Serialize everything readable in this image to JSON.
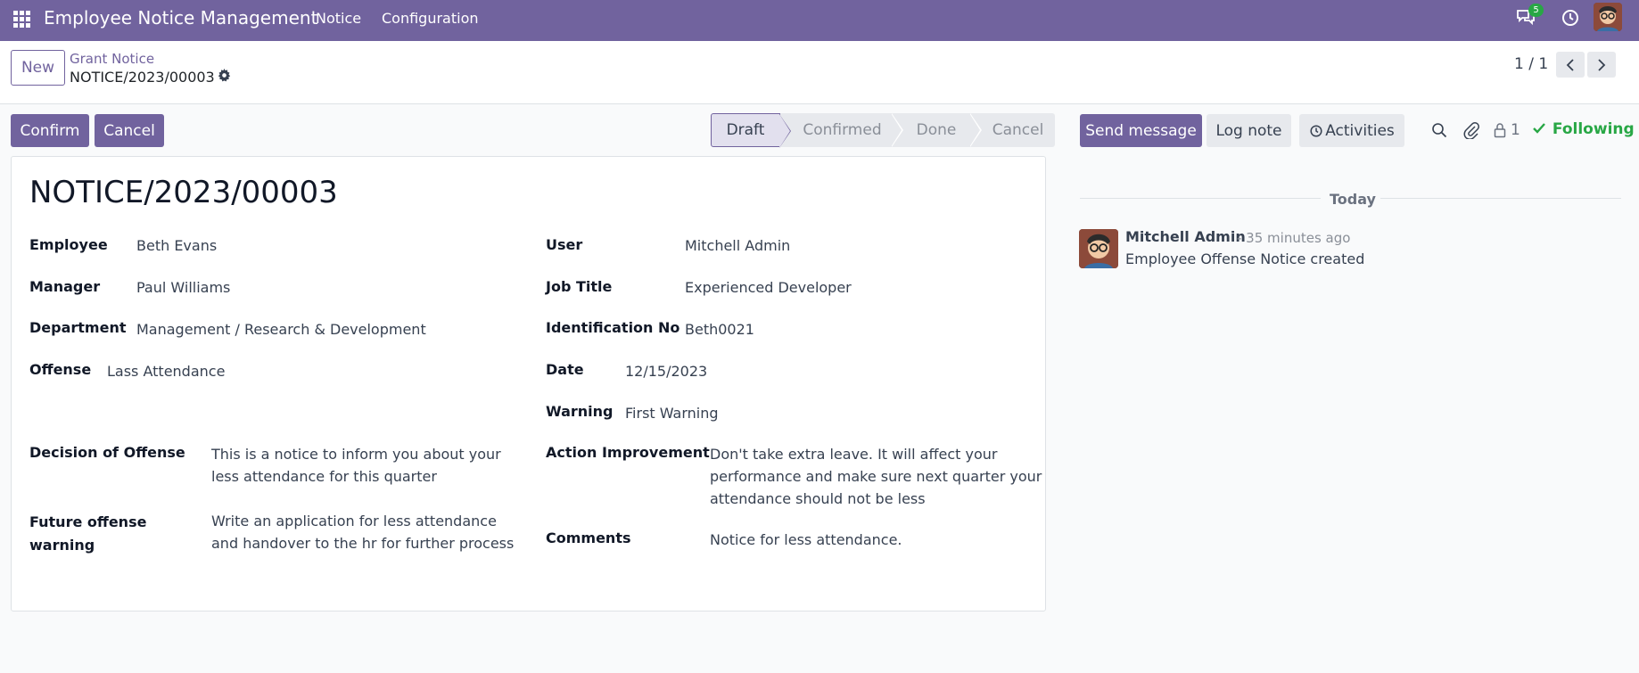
{
  "navbar": {
    "app_title": "Employee Notice Management",
    "menu": [
      "Notice",
      "Configuration"
    ],
    "messages_badge": "5",
    "accent": "#71639e"
  },
  "control_panel": {
    "new_label": "New",
    "breadcrumb_parent": "Grant Notice",
    "breadcrumb_current": "NOTICE/2023/00003",
    "pager": "1 / 1"
  },
  "actions": {
    "confirm": "Confirm",
    "cancel": "Cancel"
  },
  "statusbar": {
    "stages": [
      "Draft",
      "Confirmed",
      "Done",
      "Cancel"
    ],
    "active": "Draft"
  },
  "form": {
    "title": "NOTICE/2023/00003",
    "employee_label": "Employee",
    "employee": "Beth Evans",
    "manager_label": "Manager",
    "manager": "Paul Williams",
    "department_label": "Department",
    "department": "Management / Research & Development",
    "offense_label": "Offense",
    "offense": "Lass Attendance",
    "user_label": "User",
    "user": "Mitchell Admin",
    "job_title_label": "Job Title",
    "job_title": "Experienced Developer",
    "identification_label": "Identification No",
    "identification": "Beth0021",
    "date_label": "Date",
    "date": "12/15/2023",
    "warning_label": "Warning",
    "warning": "First Warning",
    "decision_label": "Decision of Offense",
    "decision_line1": "This is a notice to inform you about your",
    "decision_line2": "less attendance for this quarter",
    "future_label_line1": "Future offense",
    "future_label_line2": "warning",
    "future_line1": "Write an application for less attendance",
    "future_line2": "and handover to the hr for further process",
    "action_label": "Action Improvement",
    "action_line1": "Don't take extra leave. It will affect your",
    "action_line2": "performance and make sure next quarter your",
    "action_line3": "attendance should not be less",
    "comments_label": "Comments",
    "comments": "Notice for less attendance."
  },
  "chatter": {
    "send_message": "Send message",
    "log_note": "Log note",
    "activities": "Activities",
    "followers_count": "1",
    "following": "Following",
    "today": "Today",
    "message": {
      "author": "Mitchell Admin",
      "time": "- 35 minutes ago",
      "body": "Employee Offense Notice created"
    }
  }
}
